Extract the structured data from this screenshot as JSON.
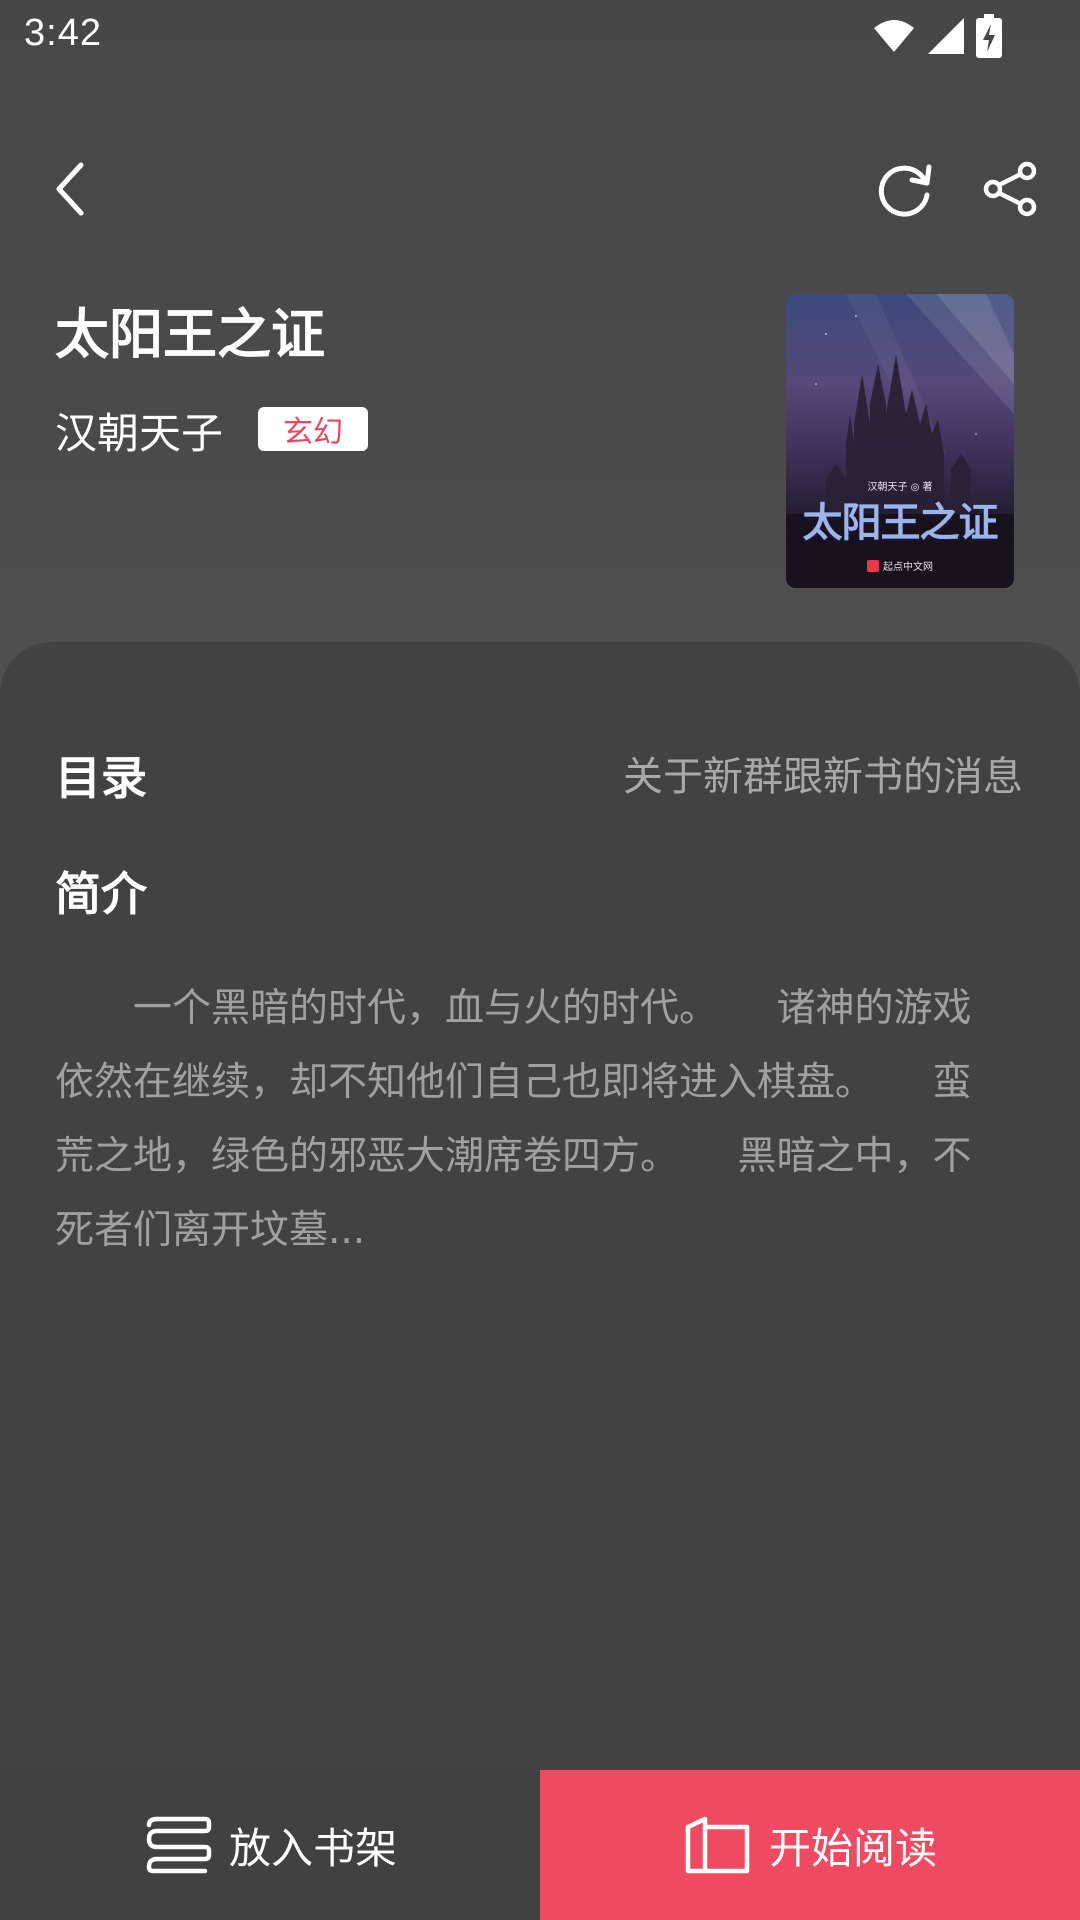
{
  "status_bar": {
    "time": "3:42"
  },
  "header": {
    "back_icon": "chevron-left-icon",
    "refresh_icon": "refresh-icon",
    "share_icon": "share-icon"
  },
  "book": {
    "title": "太阳王之证",
    "author": "汉朝天子",
    "tag": "玄幻",
    "cover": {
      "author_line": "汉朝天子 ◎ 著",
      "title": "太阳王之证",
      "publisher": "起点中文网"
    }
  },
  "toc": {
    "label": "目录",
    "latest_chapter": "关于新群跟新书的消息"
  },
  "intro": {
    "label": "简介",
    "text": "　　一个黑暗的时代，血与火的时代。　　诸神的游戏依然在继续，却不知他们自己也即将进入棋盘。　　蛮荒之地，绿色的邪恶大潮席卷四方。　　黑暗之中，不死者们离开坟墓..."
  },
  "bottom_bar": {
    "add_to_shelf_label": "放入书架",
    "start_reading_label": "开始阅读"
  },
  "colors": {
    "accent": "#ee4a62",
    "tag_text": "#e8485e",
    "background": "#444444",
    "card": "#424242"
  }
}
